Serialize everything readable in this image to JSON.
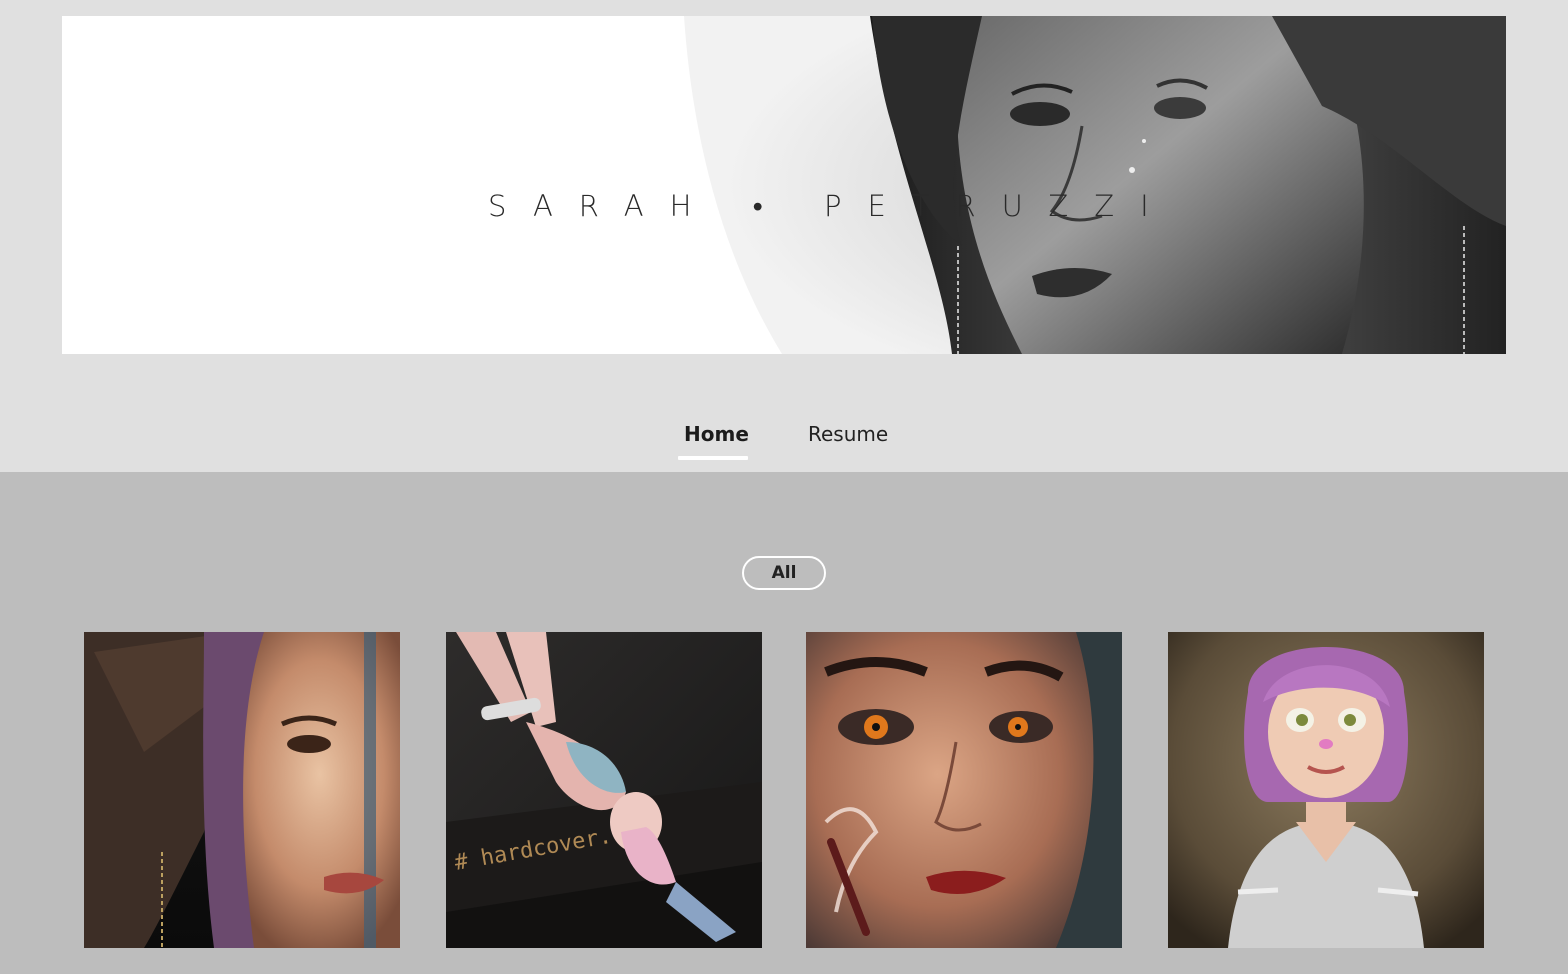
{
  "header": {
    "banner_title": "SARAH • PETRUZZI"
  },
  "nav": {
    "tabs": [
      {
        "label": "Home",
        "active": true
      },
      {
        "label": "Resume",
        "active": false
      }
    ]
  },
  "filter": {
    "label": "All"
  },
  "gallery": {
    "items": [
      {
        "image": "woman-headdress-portrait"
      },
      {
        "image": "bunny-girl-pinup",
        "caption": "# hardcover."
      },
      {
        "image": "fiery-eyes-portrait"
      },
      {
        "image": "pink-haired-cartoon-girl"
      }
    ]
  },
  "colors": {
    "top_background": "#e0e0e0",
    "content_background": "#bdbdbd",
    "accent": "#ffffff"
  }
}
